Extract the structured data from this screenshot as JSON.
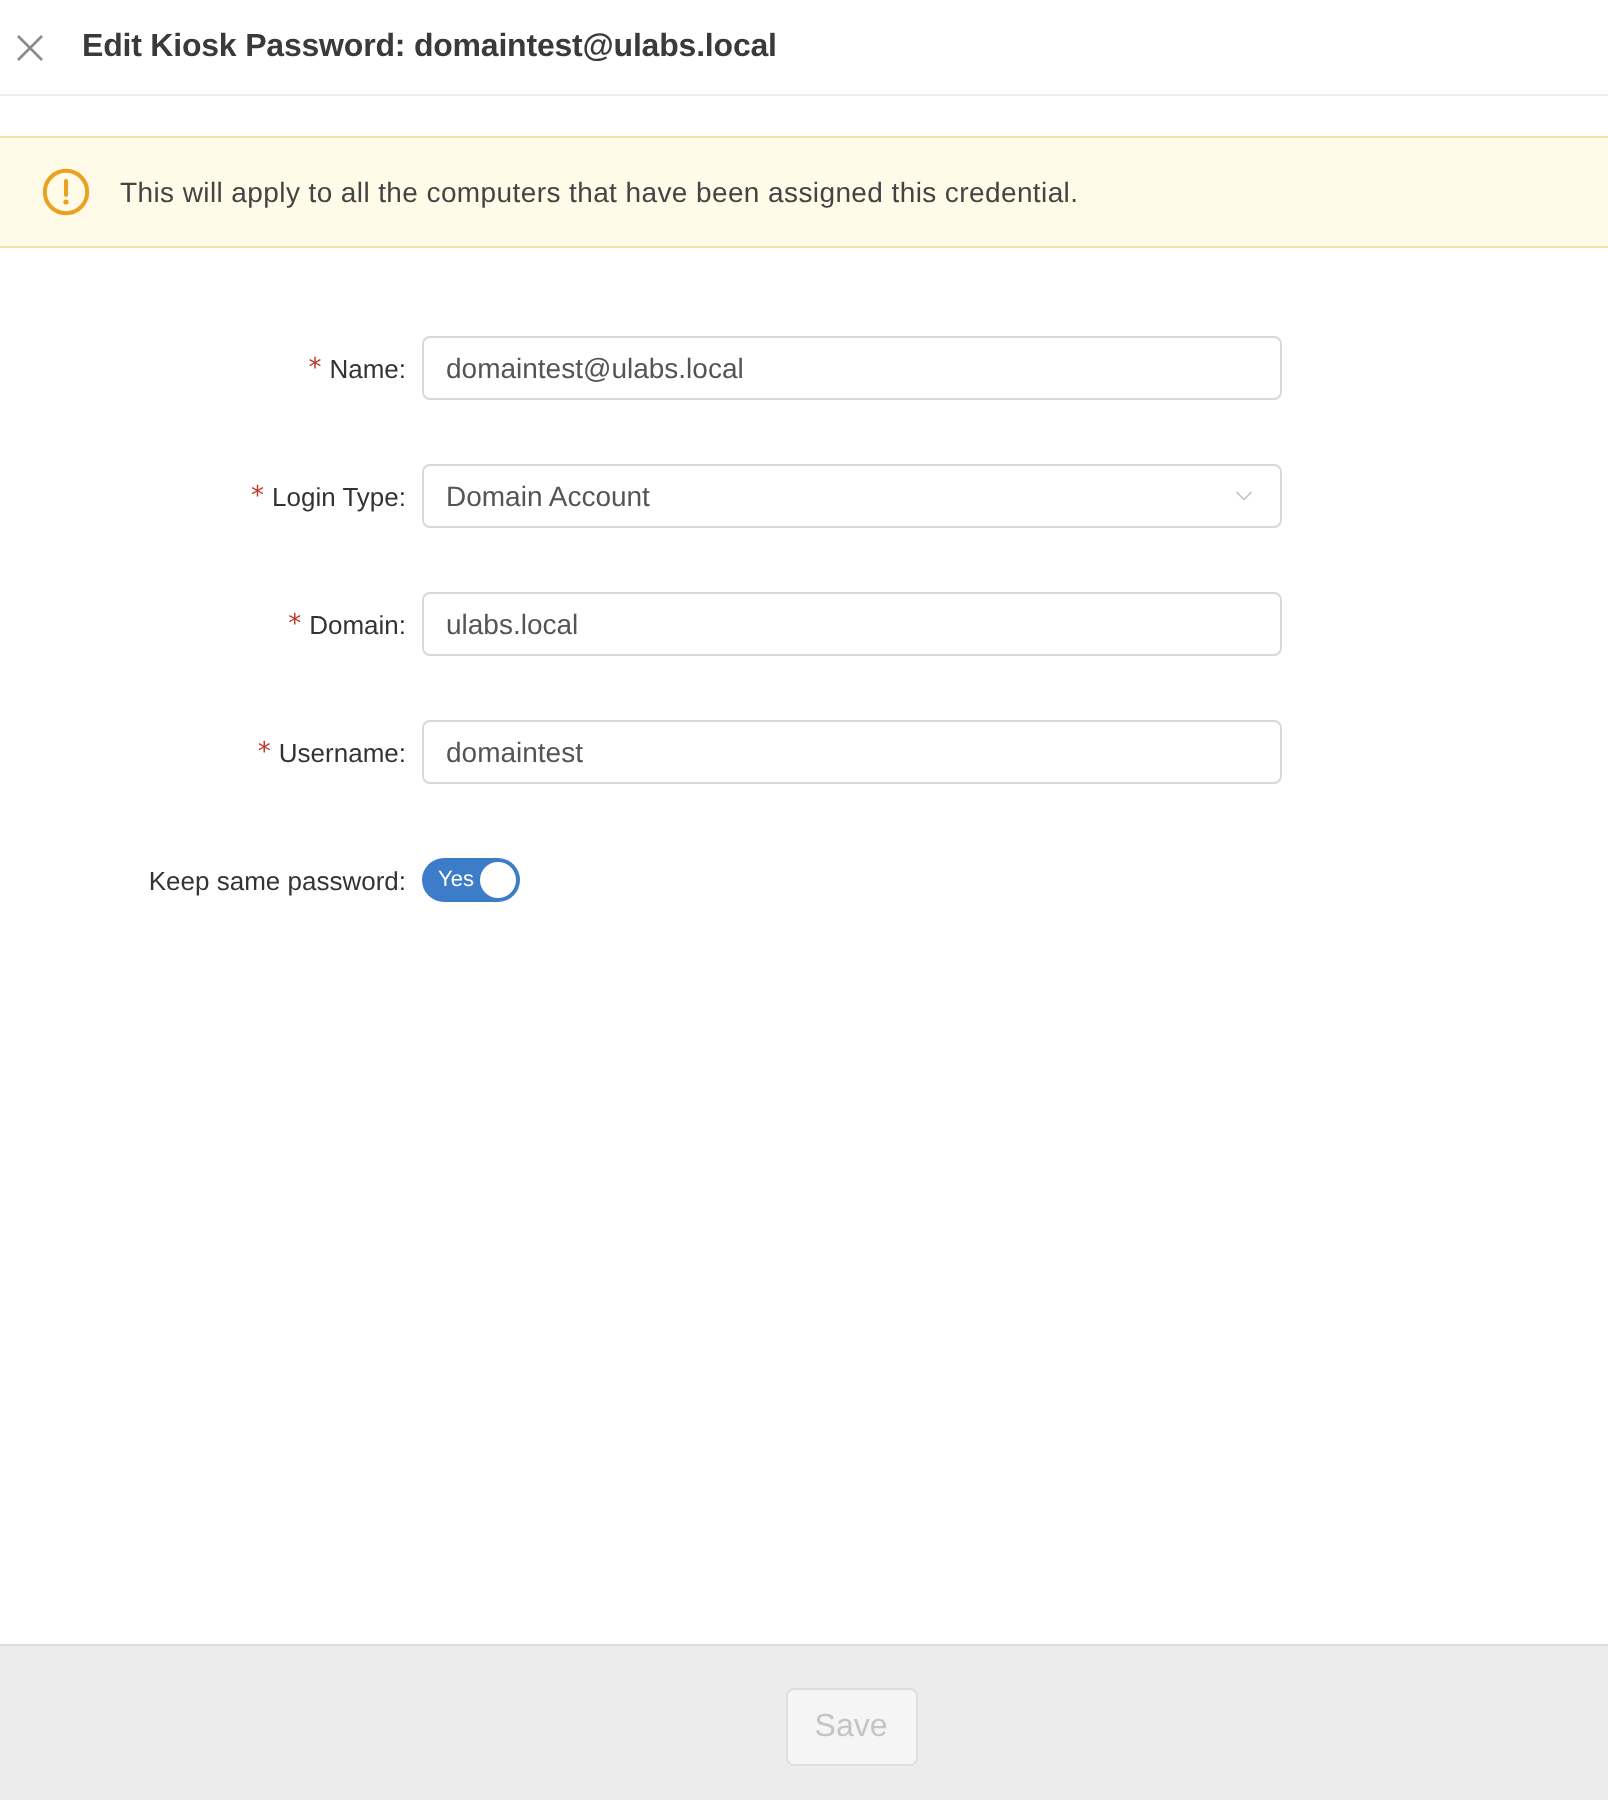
{
  "header": {
    "title": "Edit Kiosk Password: domaintest@ulabs.local"
  },
  "alert": {
    "kind": "warning",
    "message": "This will apply to all the computers that have been assigned this credential."
  },
  "form": {
    "fields": [
      {
        "kind": "input",
        "required_mark": "*",
        "label": "Name:",
        "value": "domaintest@ulabs.local"
      },
      {
        "kind": "select",
        "required_mark": "*",
        "label": "Login Type:",
        "value": "Domain Account"
      },
      {
        "kind": "input",
        "required_mark": "*",
        "label": "Domain:",
        "value": "ulabs.local"
      },
      {
        "kind": "input",
        "required_mark": "*",
        "label": "Username:",
        "value": "domaintest"
      },
      {
        "kind": "switch",
        "label": "Keep same password:",
        "on": true,
        "on_text": "Yes"
      }
    ]
  },
  "footer": {
    "save_button": {
      "label": "Save",
      "disabled": true
    }
  }
}
